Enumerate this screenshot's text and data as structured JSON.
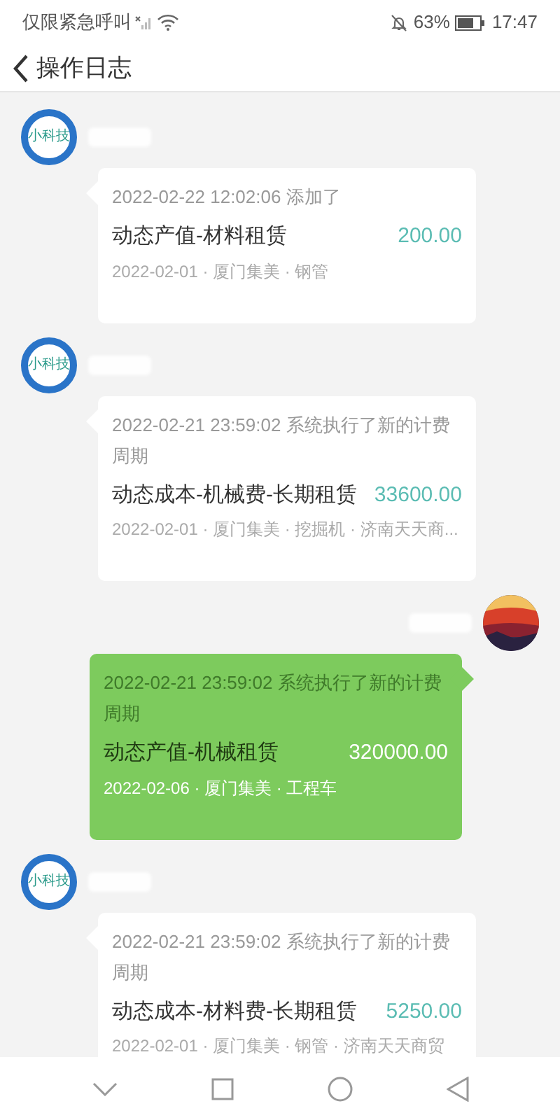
{
  "status_bar": {
    "carrier": "仅限紧急呼叫",
    "battery": "63%",
    "time": "17:47"
  },
  "header": {
    "title": "操作日志"
  },
  "messages": [
    {
      "kind": "received",
      "logo_text": "小科技",
      "event": "2022-02-22 12:02:06 添加了",
      "title": "动态产值-材料租赁",
      "amount": "200.00",
      "detail": "2022-02-01 · 厦门集美 · 钢管"
    },
    {
      "kind": "received",
      "logo_text": "小科技",
      "event": "2022-02-21 23:59:02 系统执行了新的计费周期",
      "title": "动态成本-机械费-长期租赁",
      "amount": "33600.00",
      "detail": "2022-02-01 · 厦门集美 · 挖掘机 · 济南天天商..."
    },
    {
      "kind": "sent",
      "event": "2022-02-21 23:59:02 系统执行了新的计费周期",
      "title": "动态产值-机械租赁",
      "amount": "320000.00",
      "detail": "2022-02-06 · 厦门集美 · 工程车"
    },
    {
      "kind": "received",
      "logo_text": "小科技",
      "event": "2022-02-21 23:59:02 系统执行了新的计费周期",
      "title": "动态成本-材料费-长期租赁",
      "amount": "5250.00",
      "detail": "2022-02-01 · 厦门集美 · 钢管 · 济南天天商贸"
    }
  ]
}
